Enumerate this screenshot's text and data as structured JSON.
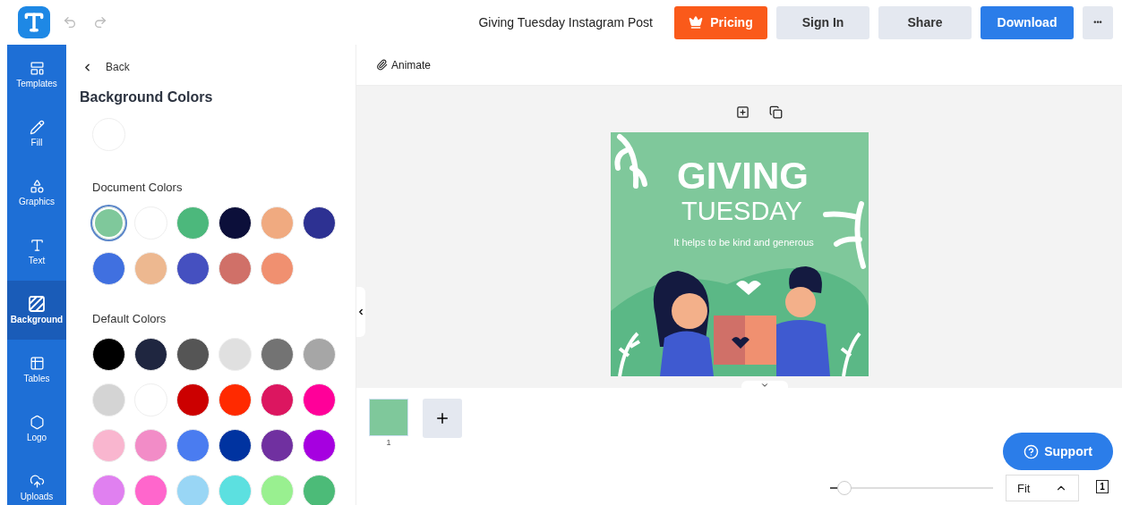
{
  "header": {
    "document_title": "Giving Tuesday Instagram Post",
    "buttons": [
      {
        "kind": "pricing",
        "label": "Pricing"
      },
      {
        "kind": "secondary",
        "label": "Sign In"
      },
      {
        "kind": "secondary",
        "label": "Share"
      },
      {
        "kind": "primary",
        "label": "Download"
      },
      {
        "kind": "more",
        "label": "•••"
      }
    ]
  },
  "rail": [
    {
      "kind": "templates",
      "label": "Templates",
      "selected": false
    },
    {
      "kind": "fill",
      "label": "Fill",
      "selected": false
    },
    {
      "kind": "graphics",
      "label": "Graphics",
      "selected": false
    },
    {
      "kind": "text",
      "label": "Text",
      "selected": false
    },
    {
      "kind": "background",
      "label": "Background",
      "selected": true
    },
    {
      "kind": "tables",
      "label": "Tables",
      "selected": false
    },
    {
      "kind": "logo",
      "label": "Logo",
      "selected": false
    },
    {
      "kind": "uploads",
      "label": "Uploads",
      "selected": false
    }
  ],
  "panel": {
    "back": "Back",
    "title": "Background Colors",
    "sections": [
      {
        "title": "Document Colors",
        "swatches": [
          {
            "color": "#7fc89b",
            "selected": true
          },
          {
            "color": "#ffffff",
            "selected": false
          },
          {
            "color": "#4cb87c",
            "selected": false
          },
          {
            "color": "#0c0f3a",
            "selected": false
          },
          {
            "color": "#f0aa80",
            "selected": false
          },
          {
            "color": "#2d3192",
            "selected": false
          },
          {
            "color": "#4070e0",
            "selected": false
          },
          {
            "color": "#edb890",
            "selected": false
          },
          {
            "color": "#4550c0",
            "selected": false
          },
          {
            "color": "#d07068",
            "selected": false
          },
          {
            "color": "#f09070",
            "selected": false
          }
        ]
      },
      {
        "title": "Default Colors",
        "swatches": [
          {
            "color": "#000000",
            "selected": false
          },
          {
            "color": "#1f2640",
            "selected": false
          },
          {
            "color": "#555555",
            "selected": false
          },
          {
            "color": "#e0e0e0",
            "selected": false
          },
          {
            "color": "#737373",
            "selected": false
          },
          {
            "color": "#a6a6a6",
            "selected": false
          },
          {
            "color": "#d4d4d4",
            "selected": false
          },
          {
            "color": "#ffffff",
            "selected": false
          },
          {
            "color": "#cc0000",
            "selected": false
          },
          {
            "color": "#ff2a00",
            "selected": false
          },
          {
            "color": "#dc1660",
            "selected": false
          },
          {
            "color": "#ff0099",
            "selected": false
          },
          {
            "color": "#f9b6cf",
            "selected": false
          },
          {
            "color": "#f28cc7",
            "selected": false
          },
          {
            "color": "#4a7cf0",
            "selected": false
          },
          {
            "color": "#0033a0",
            "selected": false
          },
          {
            "color": "#7030a0",
            "selected": false
          },
          {
            "color": "#a600e0",
            "selected": false
          },
          {
            "color": "#e080f0",
            "selected": false
          },
          {
            "color": "#ff66cc",
            "selected": false
          },
          {
            "color": "#99d6f5",
            "selected": false
          },
          {
            "color": "#5ce0e0",
            "selected": false
          },
          {
            "color": "#99f090",
            "selected": false
          },
          {
            "color": "#4cbb78",
            "selected": false
          }
        ]
      }
    ]
  },
  "toolbar": {
    "animate": "Animate"
  },
  "design": {
    "title": "GIVING",
    "subtitle": "TUESDAY",
    "tagline": "It helps to be kind and generous"
  },
  "pages": [
    {
      "number": "1",
      "selected": true
    }
  ],
  "support": "Support",
  "zoom": {
    "level": 0.08,
    "fit": "Fit",
    "page_count": "1"
  }
}
